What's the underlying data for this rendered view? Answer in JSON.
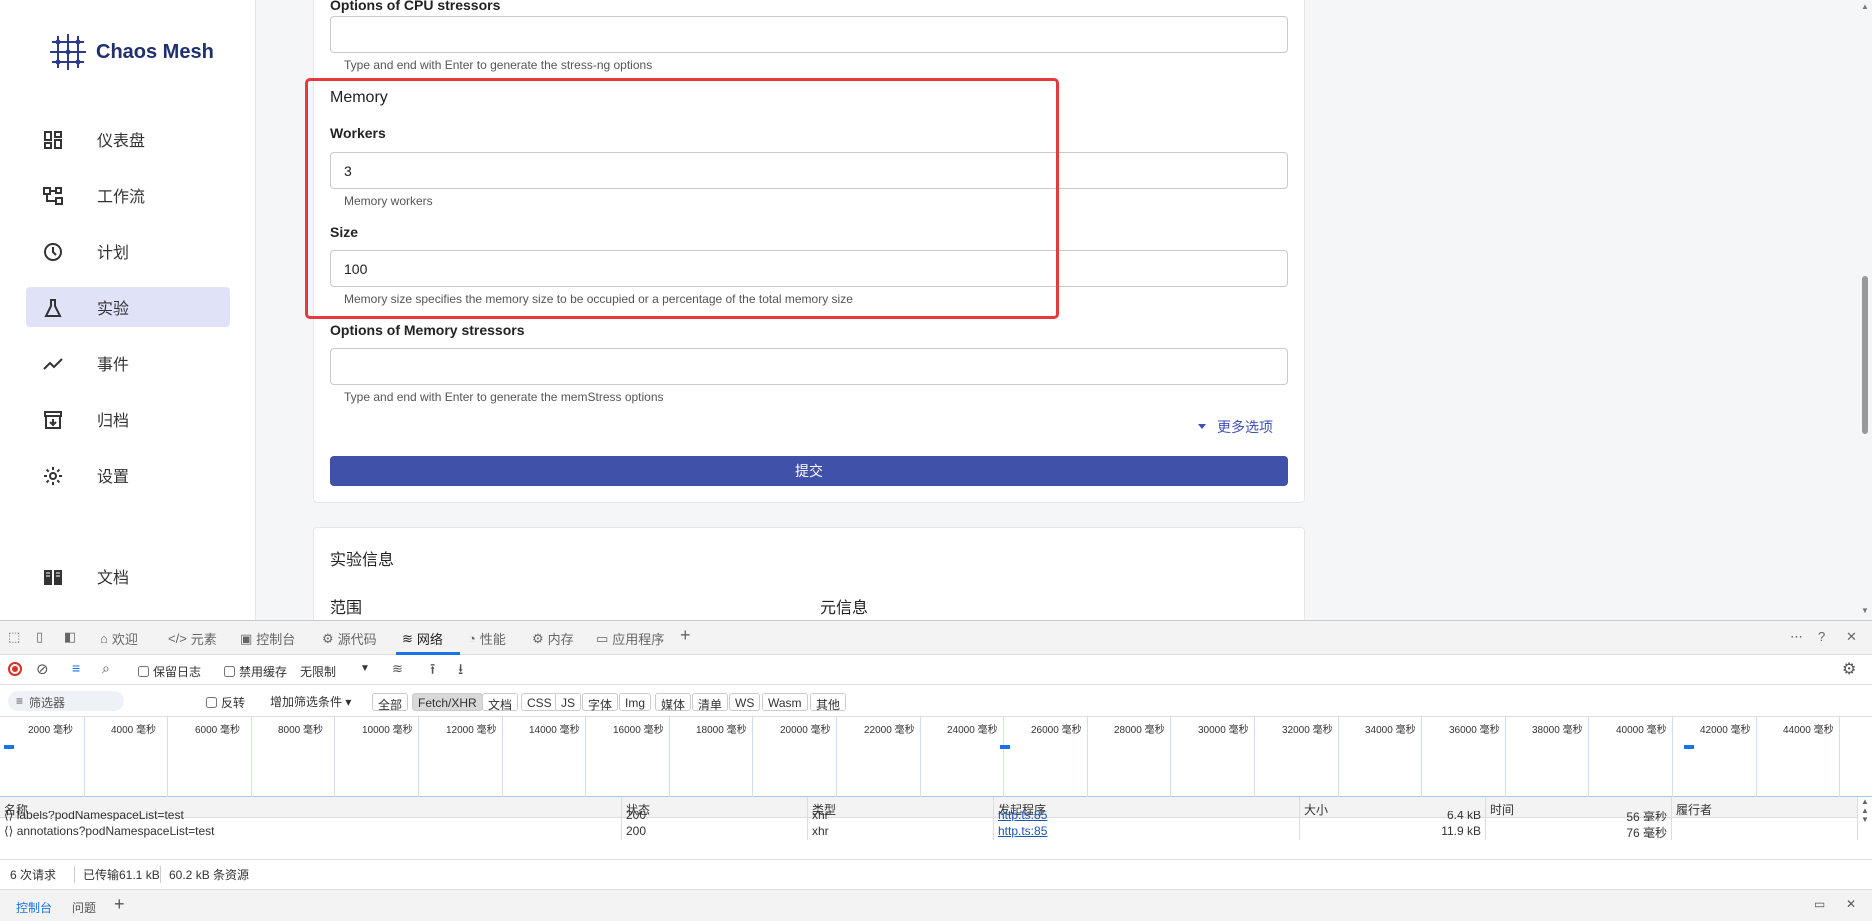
{
  "app": {
    "logo_text": "Chaos Mesh",
    "nav": [
      {
        "label": "仪表盘",
        "icon": "dashboard-icon"
      },
      {
        "label": "工作流",
        "icon": "workflow-icon"
      },
      {
        "label": "计划",
        "icon": "clock-icon"
      },
      {
        "label": "实验",
        "icon": "flask-icon",
        "active": true
      },
      {
        "label": "事件",
        "icon": "timeline-icon"
      },
      {
        "label": "归档",
        "icon": "archive-icon"
      },
      {
        "label": "设置",
        "icon": "gear-icon"
      },
      {
        "label": "文档",
        "icon": "book-icon"
      }
    ],
    "form": {
      "cpu_options_label": "Options of CPU stressors",
      "cpu_options_helper": "Type and end with Enter to generate the stress-ng options",
      "memory_title": "Memory",
      "workers_label": "Workers",
      "workers_value": "3",
      "workers_helper": "Memory workers",
      "size_label": "Size",
      "size_value": "100",
      "size_helper": "Memory size specifies the memory size to be occupied or a percentage of the total memory size",
      "mem_options_label": "Options of Memory stressors",
      "mem_options_helper": "Type and end with Enter to generate the memStress options",
      "more_options": "更多选项",
      "submit": "提交"
    },
    "info": {
      "title": "实验信息",
      "scope": "范围",
      "meta": "元信息"
    }
  },
  "devtools": {
    "tabs": [
      "欢迎",
      "元素",
      "控制台",
      "源代码",
      "网络",
      "性能",
      "内存",
      "应用程序"
    ],
    "active_tab": "网络",
    "toolbar": {
      "preserve_log": "保留日志",
      "disable_cache": "禁用缓存",
      "throttle": "无限制"
    },
    "filter": {
      "placeholder": "筛选器",
      "invert": "反转",
      "more_filters": "增加筛选条件",
      "types": [
        "全部",
        "Fetch/XHR",
        "文档",
        "CSS",
        "JS",
        "字体",
        "Img",
        "媒体",
        "清单",
        "WS",
        "Wasm",
        "其他"
      ],
      "active_type": "Fetch/XHR"
    },
    "timeline_labels": [
      "2000 毫秒",
      "4000 毫秒",
      "6000 毫秒",
      "8000 毫秒",
      "10000 毫秒",
      "12000 毫秒",
      "14000 毫秒",
      "16000 毫秒",
      "18000 毫秒",
      "20000 毫秒",
      "22000 毫秒",
      "24000 毫秒",
      "26000 毫秒",
      "28000 毫秒",
      "30000 毫秒",
      "32000 毫秒",
      "34000 毫秒",
      "36000 毫秒",
      "38000 毫秒",
      "40000 毫秒",
      "42000 毫秒",
      "44000 毫秒"
    ],
    "columns": [
      "名称",
      "状态",
      "类型",
      "发起程序",
      "大小",
      "时间",
      "履行者"
    ],
    "rows": [
      {
        "name": "labels?podNamespaceList=test",
        "status": "200",
        "type": "xhr",
        "initiator": "http.ts:85",
        "size": "6.4 kB",
        "time": "56 毫秒",
        "fulfilled": ""
      },
      {
        "name": "annotations?podNamespaceList=test",
        "status": "200",
        "type": "xhr",
        "initiator": "http.ts:85",
        "size": "11.9 kB",
        "time": "76 毫秒",
        "fulfilled": ""
      }
    ],
    "summary": {
      "requests": "6 次请求",
      "transferred": "已传输61.1 kB",
      "resources": "60.2 kB 条资源"
    },
    "drawer": {
      "console": "控制台",
      "issues": "问题"
    }
  }
}
